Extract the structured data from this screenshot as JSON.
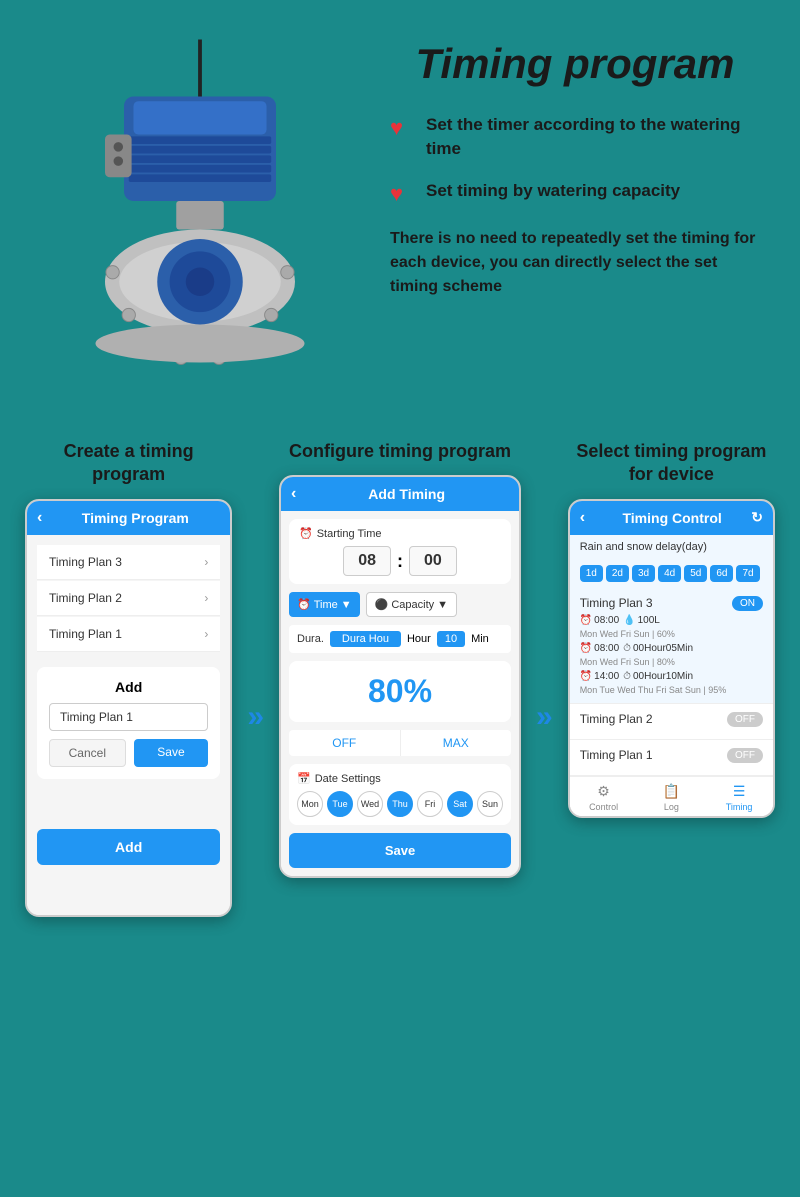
{
  "header": {
    "title": "Timing program"
  },
  "features": [
    {
      "icon": "♥",
      "text": "Set the timer according to the watering time"
    },
    {
      "icon": "♥",
      "text": "Set timing by watering capacity"
    }
  ],
  "description": "There is no need to repeatedly set the timing for each device, you can directly select the set timing scheme",
  "columns": [
    {
      "title": "Create a timing program",
      "phone": {
        "header": "Timing Program",
        "plans": [
          "Timing Plan 3",
          "Timing Plan 2",
          "Timing Plan 1"
        ],
        "dialog": {
          "title": "Add",
          "input_value": "Timing Plan 1",
          "cancel": "Cancel",
          "save": "Save"
        },
        "add_btn": "Add"
      }
    },
    {
      "title": "Configure timing program",
      "phone": {
        "header": "Add Timing",
        "starting_time_label": "Starting Time",
        "hour": "08",
        "minute": "00",
        "time_label": "Time",
        "capacity_label": "Capacity",
        "dura_label": "Dura.",
        "hour_label": "Hour",
        "min_num": "10",
        "min_label": "Min",
        "percent": "80%",
        "off": "OFF",
        "max": "MAX",
        "date_settings_label": "Date Settings",
        "days": [
          {
            "label": "Mon",
            "active": false
          },
          {
            "label": "Tue",
            "active": true
          },
          {
            "label": "Wed",
            "active": false
          },
          {
            "label": "Thu",
            "active": true
          },
          {
            "label": "Fri",
            "active": false
          },
          {
            "label": "Sat",
            "active": true
          },
          {
            "label": "Sun",
            "active": false
          }
        ],
        "save": "Save"
      }
    },
    {
      "title": "Select timing program for device",
      "phone": {
        "header": "Timing Control",
        "rain_delay": "Rain and snow delay(day)",
        "delay_days": [
          "1d",
          "2d",
          "3d",
          "4d",
          "5d",
          "6d",
          "7d"
        ],
        "plans": [
          {
            "name": "Timing Plan 3",
            "toggle": "ON",
            "entries": [
              {
                "time": "08:00",
                "capacity": "100L",
                "sub": "Mon Wed Fri Sun | 60%"
              },
              {
                "time": "08:00",
                "capacity": "00Hour05Min",
                "sub": "Mon Wed Fri Sun | 80%"
              },
              {
                "time": "14:00",
                "capacity": "00Hour10Min",
                "sub": "Mon Tue Wed Thu Fri Sat Sun | 95%"
              }
            ]
          },
          {
            "name": "Timing Plan 2",
            "toggle": "OFF",
            "entries": []
          },
          {
            "name": "Timing Plan 1",
            "toggle": "OFF",
            "entries": []
          }
        ],
        "footer": [
          {
            "label": "Control",
            "active": false
          },
          {
            "label": "Log",
            "active": false
          },
          {
            "label": "Timing",
            "active": true
          }
        ]
      }
    }
  ]
}
